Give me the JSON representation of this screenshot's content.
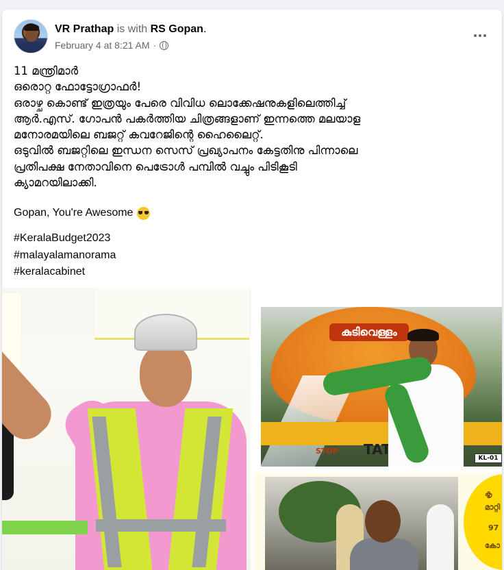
{
  "post": {
    "author": "VR Prathap",
    "is_with": "is with",
    "tagged": "RS Gopan",
    "tagged_suffix": ".",
    "date": "February 4 at 8:21 AM",
    "separator": "·",
    "body_lines": [
      "11 മന്ത്രിമാർ",
      "ഒരൊറ്റ ഫോട്ടോഗ്രാഫർ!",
      "ഒരാഴ്ച കൊണ്ട് ഇത്രയും പേരെ വിവിധ ലൊക്കേഷനുകളിലെത്തിച്ച്",
      "ആർ.എസ്. ഗോപൻ പകർത്തിയ ചിത്രങ്ങളാണ് ഇന്നത്തെ മലയാള",
      "മനോരമയിലെ ബജറ്റ് കവറേജിന്റെ ഹൈലൈറ്റ്.",
      "ഒടുവിൽ ബജറ്റിലെ ഇന്ധന സെസ് പ്രഖ്യാപനം കേട്ടതിനു പിന്നാലെ",
      "പ്രതിപക്ഷ നേതാവിനെ പെട്രോൾ പമ്പിൽ വച്ചും പിടികൂടി",
      "ക്യാമറയിലാക്കി."
    ],
    "shoutout": "Gopan, You're Awesome",
    "shoutout_emoji": "smiling-face-with-sunglasses",
    "hashtags": [
      "#KeralaBudget2023",
      "#malayalamanorama",
      "#keralacabinet"
    ]
  },
  "photos": {
    "top_right": {
      "tanker_label": "കുടിവെള്ളം",
      "stop": "STOP",
      "brand": "TAT",
      "plate": "KL-01"
    },
    "bottom_right": {
      "text_lines": [
        "കൃ",
        "മാറ്റി",
        "97",
        "കോ"
      ]
    }
  },
  "colors": {
    "background": "#f0f2f5",
    "card": "#ffffff",
    "primary_text": "#050505",
    "secondary_text": "#65676b"
  }
}
